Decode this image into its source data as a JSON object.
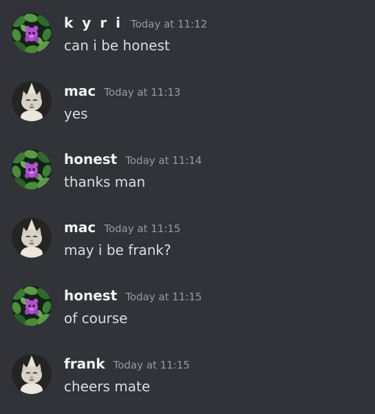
{
  "messages": [
    {
      "author": "k y r i",
      "timestamp": "Today at 11:12",
      "text": "can i be honest",
      "avatar": "plant-avatar-icon"
    },
    {
      "author": "mac",
      "timestamp": "Today at 11:13",
      "text": "yes",
      "avatar": "cat-avatar-icon"
    },
    {
      "author": "honest",
      "timestamp": "Today at 11:14",
      "text": "thanks man",
      "avatar": "plant-avatar-icon"
    },
    {
      "author": "mac",
      "timestamp": "Today at 11:15",
      "text": "may i be frank?",
      "avatar": "cat-avatar-icon"
    },
    {
      "author": "honest",
      "timestamp": "Today at 11:15",
      "text": "of course",
      "avatar": "plant-avatar-icon"
    },
    {
      "author": "frank",
      "timestamp": "Today at 11:15",
      "text": "cheers mate",
      "avatar": "cat-avatar-icon"
    }
  ],
  "colors": {
    "background": "#313338",
    "username": "#f2f3f5",
    "timestamp": "#949ba4",
    "message_text": "#dbdee1"
  }
}
